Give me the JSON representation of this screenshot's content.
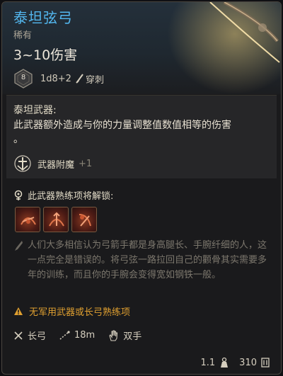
{
  "item": {
    "name": "泰坦弦弓",
    "rarity": "稀有",
    "damage": "3~10伤害",
    "dice": {
      "face": "8",
      "formula": "1d8+2",
      "damage_type": "穿刺"
    }
  },
  "weapon_section": {
    "title": "泰坦武器:",
    "description": "此武器额外造成与你的力量调整值数值相等的伤害",
    "description_end": "。",
    "enchant": {
      "label": "武器附魔",
      "value": "+1"
    }
  },
  "proficiency": {
    "title": "此武器熟练项将解锁:",
    "icons": [
      "proficiency-action-1-icon",
      "proficiency-action-2-icon",
      "proficiency-action-3-icon"
    ]
  },
  "lore": "人们大多相信认为弓箭手都是身高腿长、手腕纤细的人，这一点完全是错误的。将弓弦一路拉回自己的颧骨其实需要多年的训练，而且你的手腕会变得宽如钢铁一般。",
  "warning": "无军用武器或长弓熟练项",
  "properties": {
    "weapon_type": "长弓",
    "range": "18m",
    "handedness": "双手"
  },
  "footer": {
    "weight": "1.1",
    "price": "310"
  },
  "colors": {
    "title_blue": "#53b7ef",
    "warning_orange": "#e0a030",
    "lore_grey": "#7c776d"
  }
}
